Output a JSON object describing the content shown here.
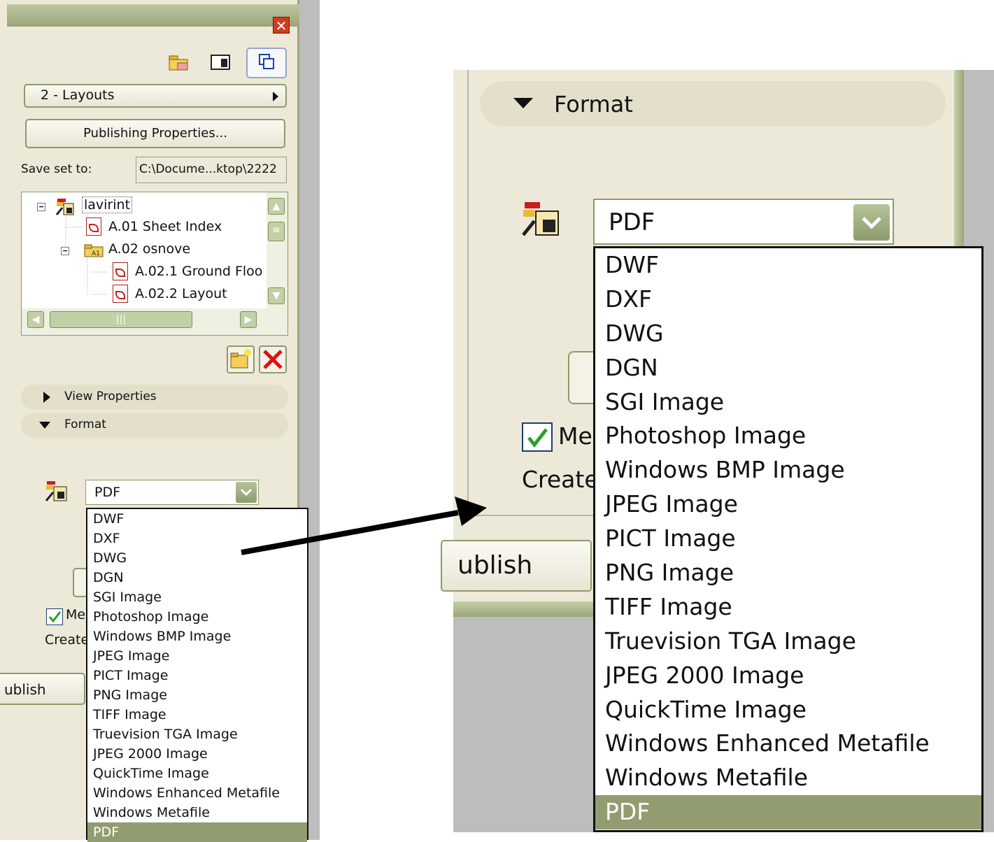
{
  "left": {
    "close_label": "✕",
    "layout_dropdown": "2 - Layouts",
    "publishing_properties_button": "Publishing Properties...",
    "save_set_label": "Save set to:",
    "save_set_path": "C:\\Docume...ktop\\2222",
    "tree": {
      "root": "lavirint",
      "item1": "A.01 Sheet Index",
      "item2": "A.02 osnove",
      "item3": "A.02.1 Ground Floo",
      "item4": "A.02.2 Layout"
    },
    "sections": {
      "view_properties": "View Properties",
      "format": "Format"
    },
    "format_selected": "PDF",
    "merge_label": "Mer",
    "create_label": "Create",
    "publish_button": "ublish"
  },
  "right": {
    "format_section": "Format",
    "format_selected": "PDF",
    "merge_label": "Mer",
    "create_label": "Create",
    "publish_button": "ublish"
  },
  "format_options": [
    "DWF",
    "DXF",
    "DWG",
    "DGN",
    "SGI Image",
    "Photoshop Image",
    "Windows BMP Image",
    "JPEG Image",
    "PICT Image",
    "PNG Image",
    "TIFF Image",
    "Truevision TGA Image",
    "JPEG 2000 Image",
    "QuickTime Image",
    "Windows Enhanced Metafile",
    "Windows Metafile",
    "PDF"
  ],
  "colors": {
    "panel_bg": "#ede9d8",
    "accent_green": "#919d70",
    "checkmark": "#2aa02a",
    "close_red": "#d23b20"
  }
}
